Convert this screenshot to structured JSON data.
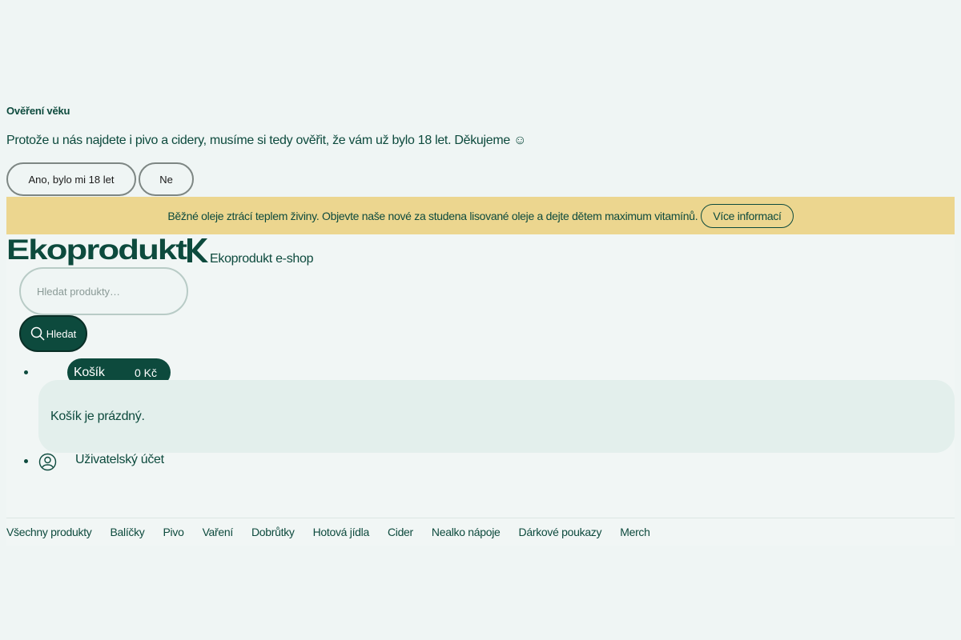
{
  "age_gate": {
    "title": "Ověření věku",
    "text": "Protože u nás najdete i pivo a cidery, musíme si tedy ověřit, že vám už bylo 18 let. Děkujeme ☺",
    "yes_label": "Ano, bylo mi 18 let",
    "no_label": "Ne"
  },
  "promo": {
    "text": "Běžné oleje ztrácí teplem živiny. Objevte naše nové za studena lisované oleje a dejte dětem maximum vitamínů.",
    "link_label": "Více informací"
  },
  "header": {
    "logo_text": "Ekoprodukt",
    "shop_label": "Ekoprodukt e-shop",
    "search_placeholder": "Hledat produkty…",
    "search_button": "Hledat"
  },
  "cart": {
    "label": "Košík",
    "amount": "0 Kč",
    "empty_message": "Košík je prázdný."
  },
  "account": {
    "label": "Uživatelský účet"
  },
  "nav": {
    "items": [
      "Všechny produkty",
      "Balíčky",
      "Pivo",
      "Vaření",
      "Dobrůtky",
      "Hotová jídla",
      "Cider",
      "Nealko nápoje",
      "Dárkové poukazy",
      "Merch"
    ]
  },
  "colors": {
    "brand_green": "#0d4a3d",
    "promo_bg": "#ecd68f",
    "page_bg": "#eff5f4"
  }
}
